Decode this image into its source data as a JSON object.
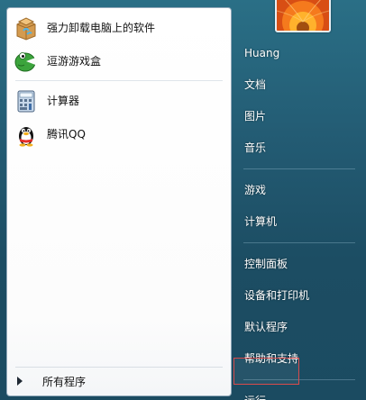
{
  "left_panel": {
    "pinned": [
      {
        "label": "强力卸载电脑上的软件",
        "icon": "uninstall-box-icon"
      },
      {
        "label": "逗游游戏盒",
        "icon": "game-box-icon"
      }
    ],
    "recent": [
      {
        "label": "计算器",
        "icon": "calculator-icon"
      },
      {
        "label": "腾讯QQ",
        "icon": "qq-penguin-icon"
      }
    ],
    "all_programs": {
      "label": "所有程序",
      "icon": "arrow-right-icon"
    }
  },
  "user": {
    "name": "Huang",
    "picture": "flower-user-picture"
  },
  "right_menu": {
    "documents": "文档",
    "pictures": "图片",
    "music": "音乐",
    "games": "游戏",
    "computer": "计算机",
    "control_panel": "控制面板",
    "devices_printers": "设备和打印机",
    "default_programs": "默认程序",
    "help_support": "帮助和支持",
    "run": "运行..."
  },
  "colors": {
    "desktop_blue": "#235b73",
    "panel_white": "#ffffff",
    "highlight_red": "#d94b4b",
    "right_text": "#ffffff"
  }
}
